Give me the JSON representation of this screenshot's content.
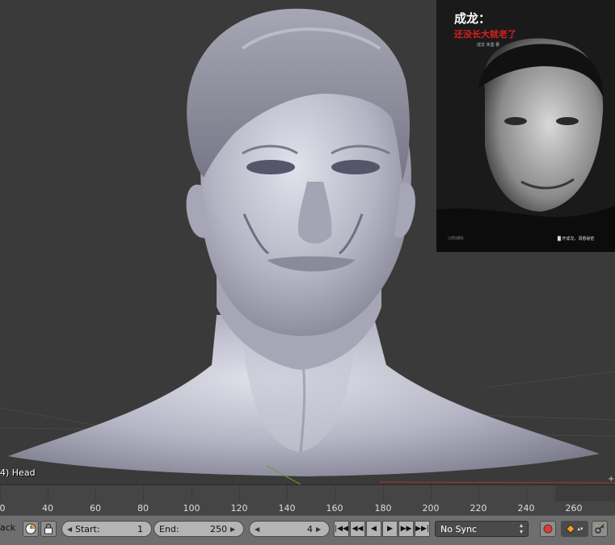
{
  "viewport": {
    "object_label": "4) Head"
  },
  "reference_image": {
    "title": "成龙：",
    "subtitle": "还没长大就老了",
    "author": "成龙 朱墨 著",
    "tagline": "█ 开成龙，洞悉秘密",
    "publisher": "江西出版社",
    "colors": {
      "title": "#ffffff",
      "subtitle": "#d42020",
      "background": "#1a1a1a"
    }
  },
  "timeline": {
    "ticks": [
      "0",
      "40",
      "60",
      "80",
      "100",
      "120",
      "140",
      "160",
      "180",
      "200",
      "220",
      "240",
      "260"
    ]
  },
  "toolbar": {
    "menu_label": "ack",
    "start_label": "Start:",
    "start_value": "1",
    "end_label": "End:",
    "end_value": "250",
    "current_frame": "4",
    "sync_label": "No Sync",
    "icons": {
      "autokey": "clock-icon",
      "lock": "lock-icon",
      "record": "record-icon",
      "keyframe": "keyframe-diamond-icon",
      "keying": "keying-set-icon"
    },
    "playback": [
      "jump-start-icon",
      "jump-prev-keyframe-icon",
      "play-reverse-icon",
      "play-icon",
      "jump-next-keyframe-icon",
      "jump-end-icon"
    ]
  },
  "colors": {
    "viewport_bg": "#3a3a3a",
    "mesh": "#b8b8c8",
    "timeline_bg": "#454545",
    "toolbar_bg": "#6e6e6e",
    "record_red": "#e03a2a",
    "keyframe_orange": "#f0a020"
  }
}
